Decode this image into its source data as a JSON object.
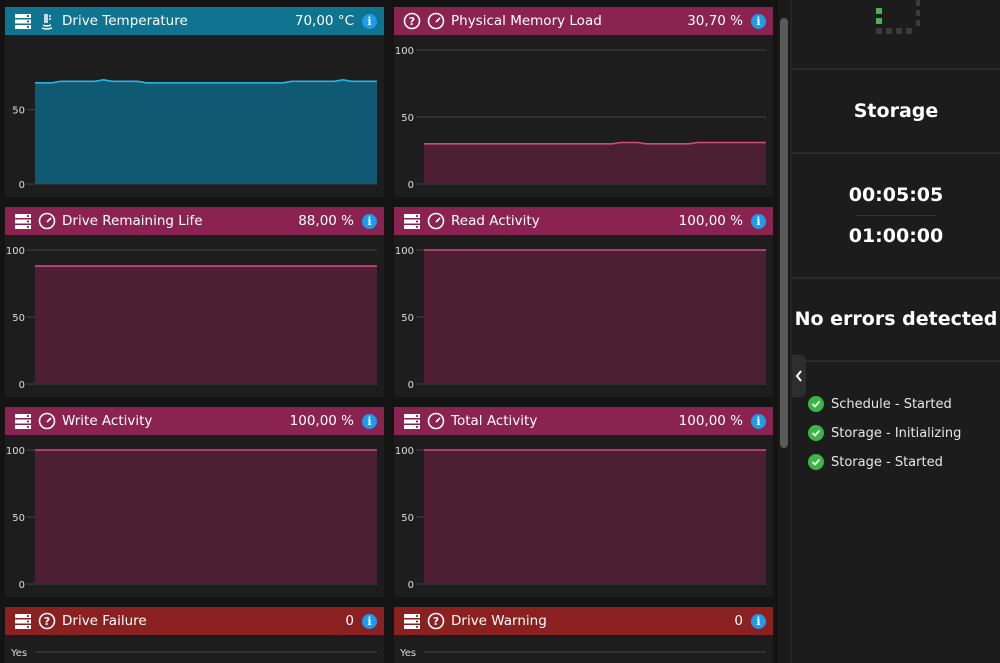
{
  "widgets": [
    {
      "id": "drive-temperature",
      "title": "Drive Temperature",
      "value": "70,00 °C",
      "icon": "thermometer-icon",
      "theme": "teal",
      "y_max": 90,
      "ticks": [
        "50",
        "0"
      ],
      "tick_values": [
        50,
        0
      ],
      "series": [
        68,
        68,
        68,
        69,
        69,
        69,
        69,
        69,
        70,
        69,
        69,
        69,
        69,
        68,
        68,
        68,
        68,
        68,
        68,
        68,
        68,
        68,
        68,
        68,
        68,
        68,
        68,
        68,
        68,
        68,
        69,
        69,
        69,
        69,
        69,
        69,
        70,
        69,
        69,
        69,
        69
      ]
    },
    {
      "id": "physical-memory-load",
      "title": "Physical Memory Load",
      "value": "30,70 %",
      "icon": "question-icon",
      "theme": "pink",
      "y_max": 100,
      "ticks": [
        "100",
        "50",
        "0"
      ],
      "tick_values": [
        100,
        50,
        0
      ],
      "series": [
        30,
        30,
        30,
        30,
        30,
        30,
        30,
        30,
        30,
        30,
        30,
        30,
        30,
        30,
        30,
        30,
        30,
        30,
        30,
        30,
        30,
        30,
        30,
        31,
        31,
        31,
        30,
        30,
        30,
        30,
        30,
        30,
        31,
        31,
        31,
        31,
        31,
        31,
        31,
        31,
        31
      ]
    },
    {
      "id": "drive-remaining-life",
      "title": "Drive Remaining Life",
      "value": "88,00 %",
      "icon": "drive-icon",
      "theme": "pink",
      "y_max": 100,
      "ticks": [
        "100",
        "50",
        "0"
      ],
      "tick_values": [
        100,
        50,
        0
      ],
      "series": [
        88,
        88,
        88,
        88,
        88,
        88,
        88,
        88,
        88,
        88,
        88,
        88,
        88,
        88,
        88,
        88,
        88,
        88,
        88,
        88,
        88,
        88,
        88,
        88,
        88,
        88,
        88,
        88,
        88,
        88,
        88,
        88,
        88,
        88,
        88,
        88,
        88,
        88,
        88,
        88,
        88
      ]
    },
    {
      "id": "read-activity",
      "title": "Read Activity",
      "value": "100,00 %",
      "icon": "drive-icon",
      "theme": "pink",
      "y_max": 100,
      "ticks": [
        "100",
        "50",
        "0"
      ],
      "tick_values": [
        100,
        50,
        0
      ],
      "series": [
        100,
        100,
        100,
        100,
        100,
        100,
        100,
        100,
        100,
        100,
        100,
        100,
        100,
        100,
        100,
        100,
        100,
        100,
        100,
        100,
        100,
        100,
        100,
        100,
        100,
        100,
        100,
        100,
        100,
        100,
        100,
        100,
        100,
        100,
        100,
        100,
        100,
        100,
        100,
        100,
        100
      ]
    },
    {
      "id": "write-activity",
      "title": "Write Activity",
      "value": "100,00 %",
      "icon": "drive-icon",
      "theme": "pink",
      "y_max": 100,
      "ticks": [
        "100",
        "50",
        "0"
      ],
      "tick_values": [
        100,
        50,
        0
      ],
      "series": [
        100,
        100,
        100,
        100,
        100,
        100,
        100,
        100,
        100,
        100,
        100,
        100,
        100,
        100,
        100,
        100,
        100,
        100,
        100,
        100,
        100,
        100,
        100,
        100,
        100,
        100,
        100,
        100,
        100,
        100,
        100,
        100,
        100,
        100,
        100,
        100,
        100,
        100,
        100,
        100,
        100
      ]
    },
    {
      "id": "total-activity",
      "title": "Total Activity",
      "value": "100,00 %",
      "icon": "drive-icon",
      "theme": "pink",
      "y_max": 100,
      "ticks": [
        "100",
        "50",
        "0"
      ],
      "tick_values": [
        100,
        50,
        0
      ],
      "series": [
        100,
        100,
        100,
        100,
        100,
        100,
        100,
        100,
        100,
        100,
        100,
        100,
        100,
        100,
        100,
        100,
        100,
        100,
        100,
        100,
        100,
        100,
        100,
        100,
        100,
        100,
        100,
        100,
        100,
        100,
        100,
        100,
        100,
        100,
        100,
        100,
        100,
        100,
        100,
        100,
        100
      ]
    },
    {
      "id": "drive-failure",
      "title": "Drive Failure",
      "value": "0",
      "icon": "question-icon",
      "theme": "red",
      "ticks": [
        "Yes"
      ]
    },
    {
      "id": "drive-warning",
      "title": "Drive Warning",
      "value": "0",
      "icon": "question-icon",
      "theme": "red",
      "ticks": [
        "Yes"
      ]
    }
  ],
  "colors": {
    "teal_header": "#0e7490",
    "teal_fill": "#0f5a72",
    "teal_line": "#29b3e6",
    "pink_header": "#8b2350",
    "pink_fill": "#4d1f33",
    "pink_line": "#d24b7c",
    "red_header": "#8b2020",
    "grid": "#444444",
    "tick_text": "#dddddd"
  },
  "right_panel": {
    "title": "Storage",
    "elapsed": "00:05:05",
    "duration": "01:00:00",
    "error_status": "No errors detected",
    "events": [
      "Schedule - Started",
      "Storage - Initializing",
      "Storage - Started"
    ]
  }
}
